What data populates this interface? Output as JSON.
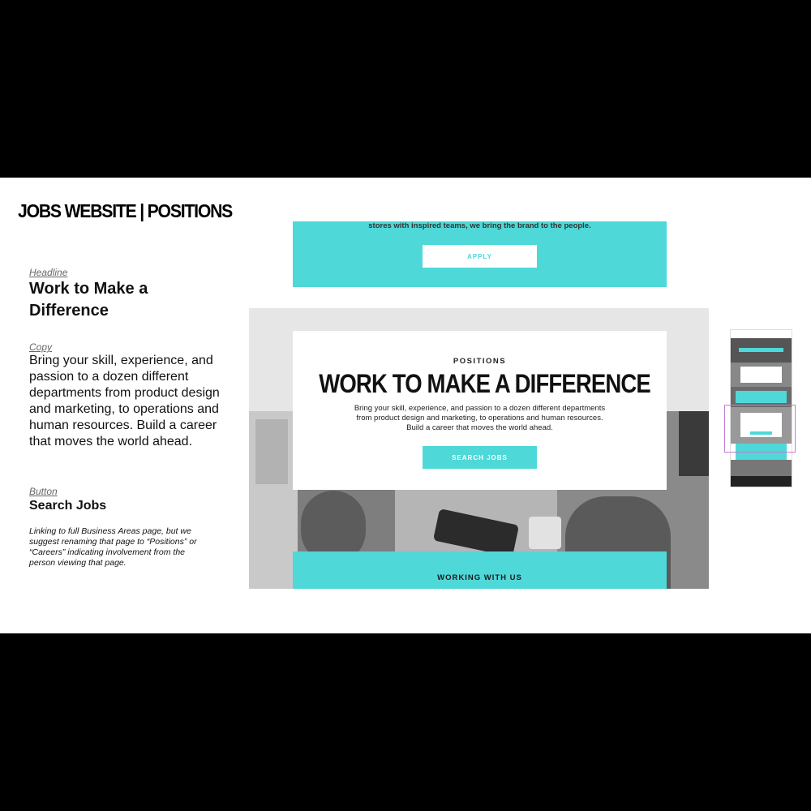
{
  "slide_title": "JOBS WEBSITE | POSITIONS",
  "notes": {
    "headline_label": "Headline",
    "headline": "Work to Make a Difference",
    "copy_label": "Copy",
    "copy": "Bring your skill, experience, and passion to a dozen different departments from product design and marketing, to operations and human resources. Build a career that moves the world ahead.",
    "button_label": "Button",
    "button": "Search Jobs",
    "note": "Linking to full Business Areas page, but we suggest renaming that page to “Positions” or “Careers” indicating involvement from the person viewing that page."
  },
  "mockup": {
    "top_cut_text": "stores with inspired teams, we bring the brand to the people.",
    "apply_button": "APPLY",
    "kicker": "POSITIONS",
    "headline": "WORK TO MAKE A DIFFERENCE",
    "body": "Bring your skill, experience, and passion to a dozen different departments from product design and marketing, to operations and human resources. Build a career that moves the world ahead.",
    "search_button": "SEARCH JOBS",
    "next_section": "WORKING WITH US"
  },
  "colors": {
    "accent": "#4fd8d8",
    "highlight": "#c27bd4"
  }
}
